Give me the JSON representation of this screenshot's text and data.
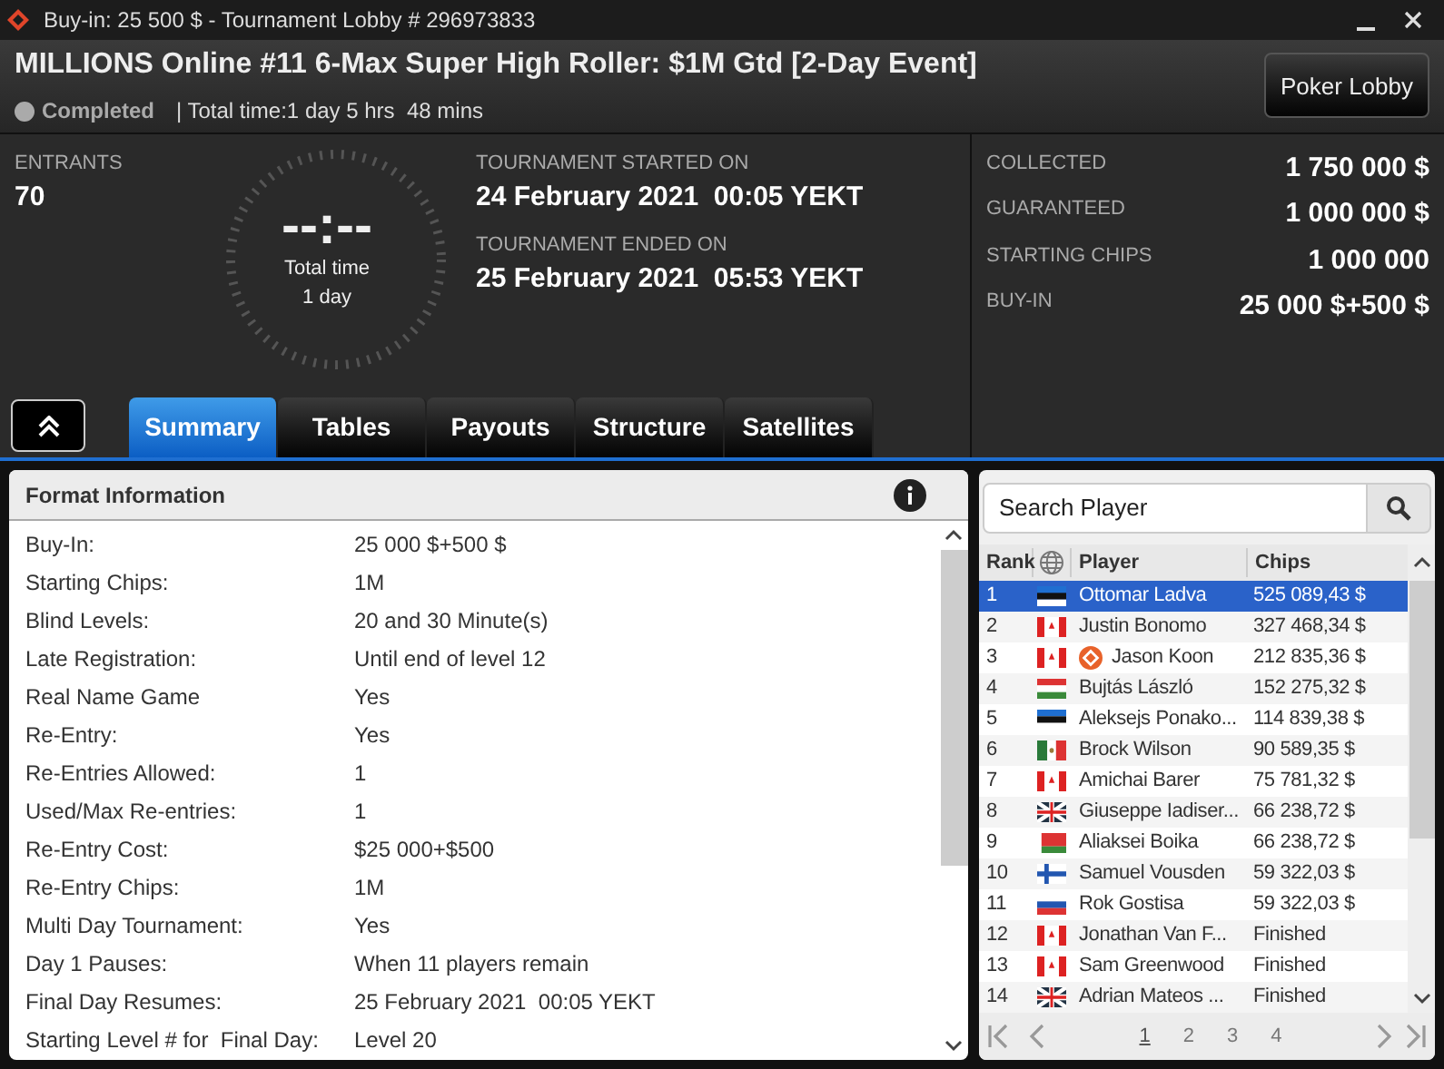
{
  "window": {
    "title": "Buy-in: 25 500 $ - Tournament Lobby # 296973833"
  },
  "header": {
    "title": "MILLIONS Online #11 6-Max Super High Roller: $1M Gtd [2-Day Event]",
    "status": "Completed",
    "total_time": "| Total time:1 day 5 hrs  48 mins",
    "lobby_button": "Poker Lobby"
  },
  "entrants": {
    "label": "ENTRANTS",
    "value": "70"
  },
  "timer": {
    "display": "--:--",
    "caption": "Total time",
    "sub": "1 day"
  },
  "dates": [
    {
      "label": "TOURNAMENT STARTED ON",
      "value": "24 February 2021  00:05 YEKT"
    },
    {
      "label": "TOURNAMENT ENDED ON",
      "value": "25 February 2021  05:53 YEKT"
    }
  ],
  "prize_info": [
    {
      "label": "COLLECTED",
      "value": "1 750 000 $"
    },
    {
      "label": "GUARANTEED",
      "value": "1 000 000 $"
    },
    {
      "label": "STARTING CHIPS",
      "value": "1 000 000"
    },
    {
      "label": "BUY-IN",
      "value": "25 000 $+500 $"
    }
  ],
  "tabs": [
    {
      "label": "Summary",
      "selected": true
    },
    {
      "label": "Tables",
      "selected": false
    },
    {
      "label": "Payouts",
      "selected": false
    },
    {
      "label": "Structure",
      "selected": false
    },
    {
      "label": "Satellites",
      "selected": false
    }
  ],
  "format": {
    "title": "Format Information",
    "rows": [
      {
        "label": "Buy-In:",
        "value": "25 000 $+500 $"
      },
      {
        "label": "Starting Chips:",
        "value": "1M"
      },
      {
        "label": "Blind Levels:",
        "value": "20 and 30 Minute(s)"
      },
      {
        "label": "Late Registration:",
        "value": "Until end of level 12"
      },
      {
        "label": "Real Name Game",
        "value": "Yes"
      },
      {
        "label": "Re-Entry:",
        "value": "Yes"
      },
      {
        "label": "Re-Entries Allowed:",
        "value": "1"
      },
      {
        "label": "Used/Max Re-entries:",
        "value": "1"
      },
      {
        "label": "Re-Entry Cost:",
        "value": "$25 000+$500"
      },
      {
        "label": "Re-Entry Chips:",
        "value": "1M"
      },
      {
        "label": "Multi Day Tournament:",
        "value": "Yes"
      },
      {
        "label": "Day 1 Pauses:",
        "value": "When 11 players remain"
      },
      {
        "label": "Final Day Resumes:",
        "value": "25 February 2021  00:05 YEKT"
      },
      {
        "label": "Starting Level # for  Final Day:",
        "value": "Level 20"
      }
    ]
  },
  "players": {
    "search": {
      "placeholder": "Search Player"
    },
    "columns": [
      "Rank",
      "Player",
      "Chips"
    ],
    "rows": [
      {
        "rank": "1",
        "kind": "ee",
        "player": "Ottomar Ladva",
        "chips": "525 089,43 $",
        "selected": true,
        "badge": false
      },
      {
        "rank": "2",
        "kind": "ca",
        "player": "Justin Bonomo",
        "chips": "327 468,34 $",
        "selected": false,
        "badge": false
      },
      {
        "rank": "3",
        "kind": "ca",
        "player": "Jason Koon",
        "chips": "212 835,36 $",
        "selected": false,
        "badge": true
      },
      {
        "rank": "4",
        "kind": "hu",
        "player": "Bujtás László",
        "chips": "152 275,32 $",
        "selected": false,
        "badge": false
      },
      {
        "rank": "5",
        "kind": "ee",
        "player": "Aleksejs Ponako...",
        "chips": "114 839,38 $",
        "selected": false,
        "badge": false
      },
      {
        "rank": "6",
        "kind": "mx",
        "player": "Brock Wilson",
        "chips": "90 589,35 $",
        "selected": false,
        "badge": false
      },
      {
        "rank": "7",
        "kind": "ca",
        "player": "Amichai Barer",
        "chips": "75 781,32 $",
        "selected": false,
        "badge": false
      },
      {
        "rank": "8",
        "kind": "gb",
        "player": "Giuseppe Iadiser...",
        "chips": "66 238,72 $",
        "selected": false,
        "badge": false
      },
      {
        "rank": "9",
        "kind": "by",
        "player": "Aliaksei Boika",
        "chips": "66 238,72 $",
        "selected": false,
        "badge": false
      },
      {
        "rank": "10",
        "kind": "fi",
        "player": "Samuel Vousden",
        "chips": "59 322,03 $",
        "selected": false,
        "badge": false
      },
      {
        "rank": "11",
        "kind": "si",
        "player": "Rok Gostisa",
        "chips": "59 322,03 $",
        "selected": false,
        "badge": false
      },
      {
        "rank": "12",
        "kind": "ca",
        "player": "Jonathan Van F...",
        "chips": "Finished",
        "selected": false,
        "badge": false
      },
      {
        "rank": "13",
        "kind": "ca",
        "player": "Sam Greenwood",
        "chips": "Finished",
        "selected": false,
        "badge": false
      },
      {
        "rank": "14",
        "kind": "gb",
        "player": "Adrian Mateos ...",
        "chips": "Finished",
        "selected": false,
        "badge": false
      }
    ],
    "pages": [
      {
        "label": "1",
        "selected": true
      },
      {
        "label": "2",
        "selected": false
      },
      {
        "label": "3",
        "selected": false
      },
      {
        "label": "4",
        "selected": false
      }
    ]
  }
}
